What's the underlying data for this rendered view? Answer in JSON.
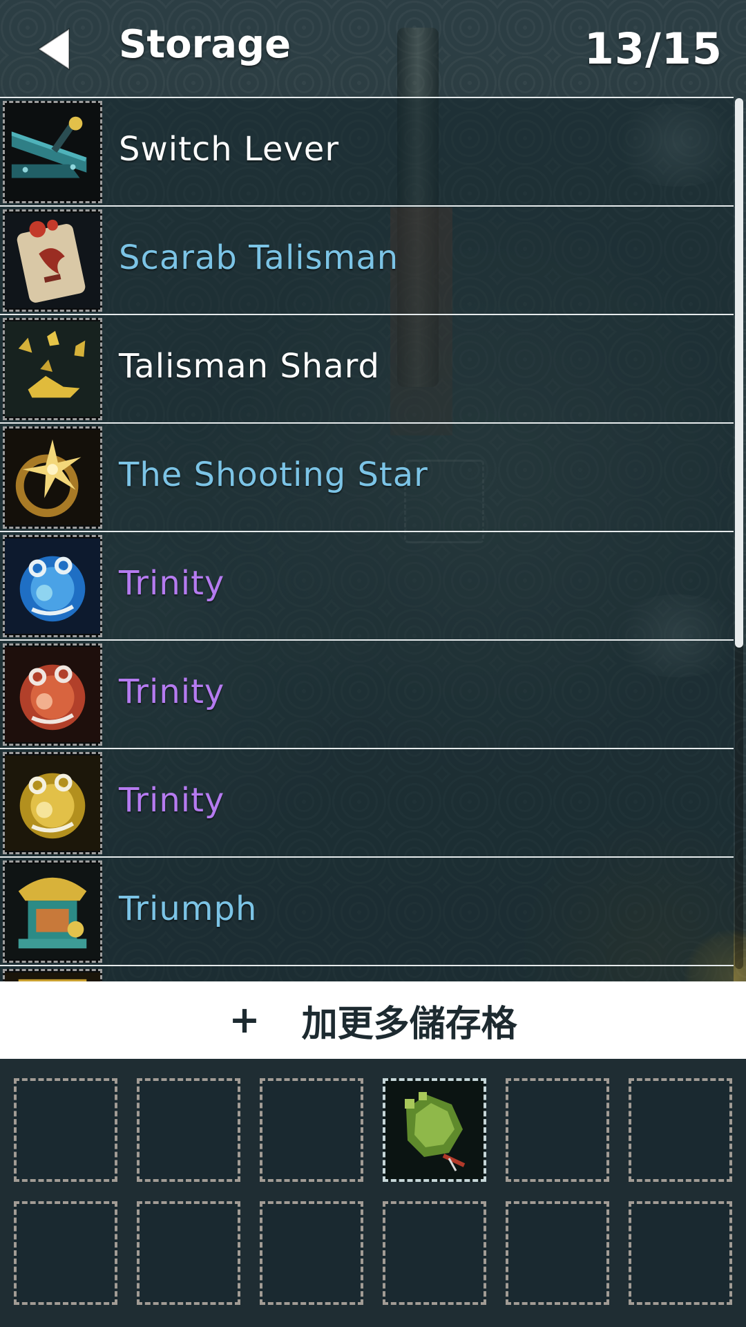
{
  "header": {
    "title": "Storage",
    "count": "13/15",
    "back_icon": "back-arrow-icon"
  },
  "items": [
    {
      "name": "Switch Lever",
      "color": "#ffffff",
      "icon": "switch-lever-icon"
    },
    {
      "name": "Scarab Talisman",
      "color": "#7cc4e6",
      "icon": "scarab-talisman-icon"
    },
    {
      "name": "Talisman Shard",
      "color": "#ffffff",
      "icon": "talisman-shard-icon"
    },
    {
      "name": "The Shooting Star",
      "color": "#7cc4e6",
      "icon": "shooting-star-icon"
    },
    {
      "name": "Trinity",
      "color": "#b57bf0",
      "icon": "trinity-blue-icon"
    },
    {
      "name": "Trinity",
      "color": "#b57bf0",
      "icon": "trinity-red-icon"
    },
    {
      "name": "Trinity",
      "color": "#b57bf0",
      "icon": "trinity-gold-icon"
    },
    {
      "name": "Triumph",
      "color": "#7cc4e6",
      "icon": "triumph-icon"
    }
  ],
  "add_slots": {
    "icon": "plus-icon",
    "label": "加更多儲存格"
  },
  "slots": {
    "filled_slot_icon": "green-gauntlet-icon"
  }
}
